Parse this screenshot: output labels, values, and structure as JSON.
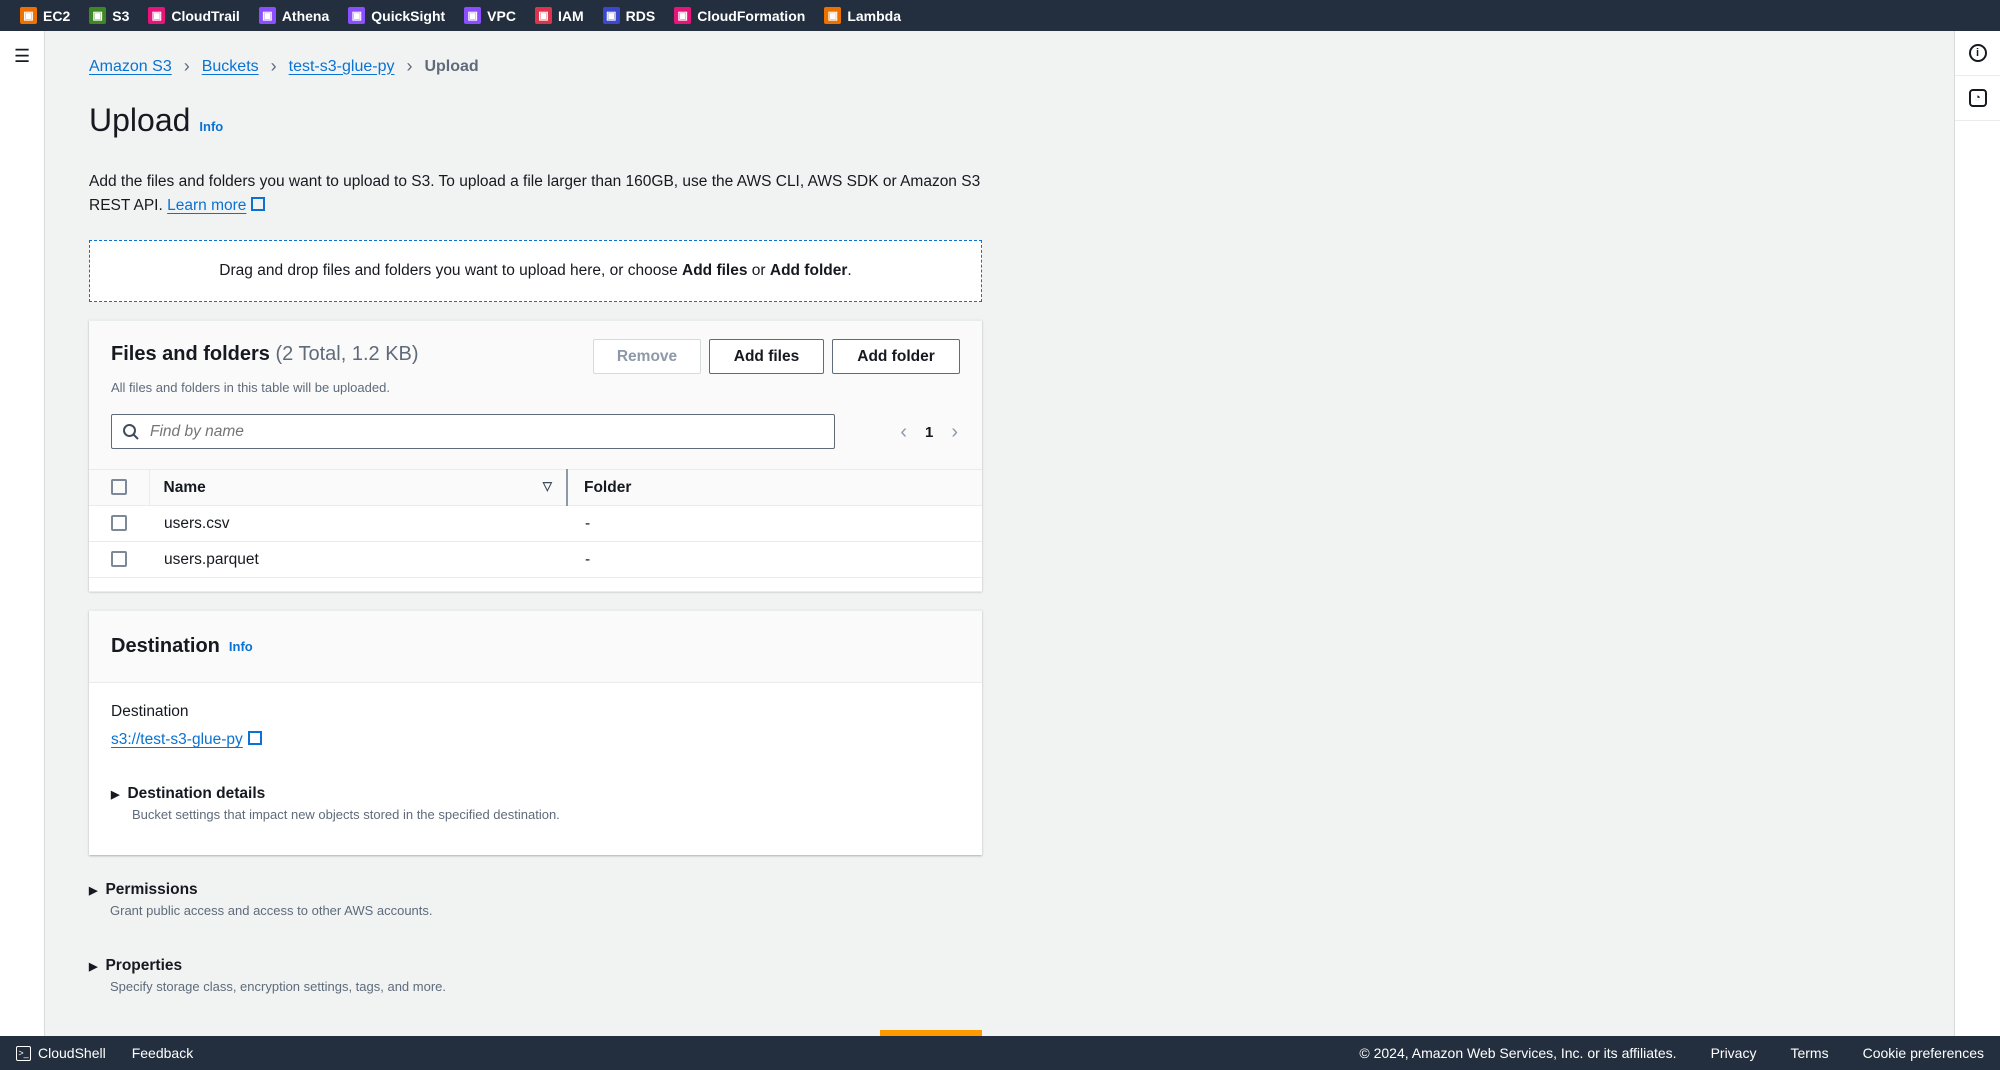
{
  "topbar": {
    "services": [
      {
        "label": "EC2",
        "color": "#ed7100",
        "icon": "ec2-icon"
      },
      {
        "label": "S3",
        "color": "#3f8624",
        "icon": "s3-icon"
      },
      {
        "label": "CloudTrail",
        "color": "#e7157b",
        "icon": "cloudtrail-icon"
      },
      {
        "label": "Athena",
        "color": "#8c4fff",
        "icon": "athena-icon"
      },
      {
        "label": "QuickSight",
        "color": "#8c4fff",
        "icon": "quicksight-icon"
      },
      {
        "label": "VPC",
        "color": "#8c4fff",
        "icon": "vpc-icon"
      },
      {
        "label": "IAM",
        "color": "#dd344c",
        "icon": "iam-icon"
      },
      {
        "label": "RDS",
        "color": "#3b48cc",
        "icon": "rds-icon"
      },
      {
        "label": "CloudFormation",
        "color": "#e7157b",
        "icon": "cloudformation-icon"
      },
      {
        "label": "Lambda",
        "color": "#ed7100",
        "icon": "lambda-icon"
      }
    ]
  },
  "breadcrumb": {
    "items": [
      "Amazon S3",
      "Buckets",
      "test-s3-glue-py"
    ],
    "current": "Upload"
  },
  "page": {
    "title": "Upload",
    "info": "Info",
    "description": "Add the files and folders you want to upload to S3. To upload a file larger than 160GB, use the AWS CLI, AWS SDK or Amazon S3 REST API.",
    "learn_more": "Learn more"
  },
  "dropzone": {
    "text_pre": "Drag and drop files and folders you want to upload here, or choose ",
    "add_files": "Add files",
    "or": " or ",
    "add_folder": "Add folder",
    "end": "."
  },
  "files": {
    "title": "Files and folders",
    "count": "(2 Total, 1.2 KB)",
    "subtitle": "All files and folders in this table will be uploaded.",
    "remove": "Remove",
    "add_files": "Add files",
    "add_folder": "Add folder",
    "search_placeholder": "Find by name",
    "page": "1",
    "columns": [
      "Name",
      "Folder"
    ],
    "rows": [
      {
        "name": "users.csv",
        "folder": "-"
      },
      {
        "name": "users.parquet",
        "folder": "-"
      }
    ]
  },
  "destination": {
    "title": "Destination",
    "info": "Info",
    "label": "Destination",
    "url": "s3://test-s3-glue-py",
    "details_title": "Destination details",
    "details_sub": "Bucket settings that impact new objects stored in the specified destination."
  },
  "permissions": {
    "title": "Permissions",
    "sub": "Grant public access and access to other AWS accounts."
  },
  "properties": {
    "title": "Properties",
    "sub": "Specify storage class, encryption settings, tags, and more."
  },
  "footer": {
    "cloudshell": "CloudShell",
    "feedback": "Feedback",
    "copyright": "© 2024, Amazon Web Services, Inc. or its affiliates.",
    "privacy": "Privacy",
    "terms": "Terms",
    "cookies": "Cookie preferences"
  }
}
